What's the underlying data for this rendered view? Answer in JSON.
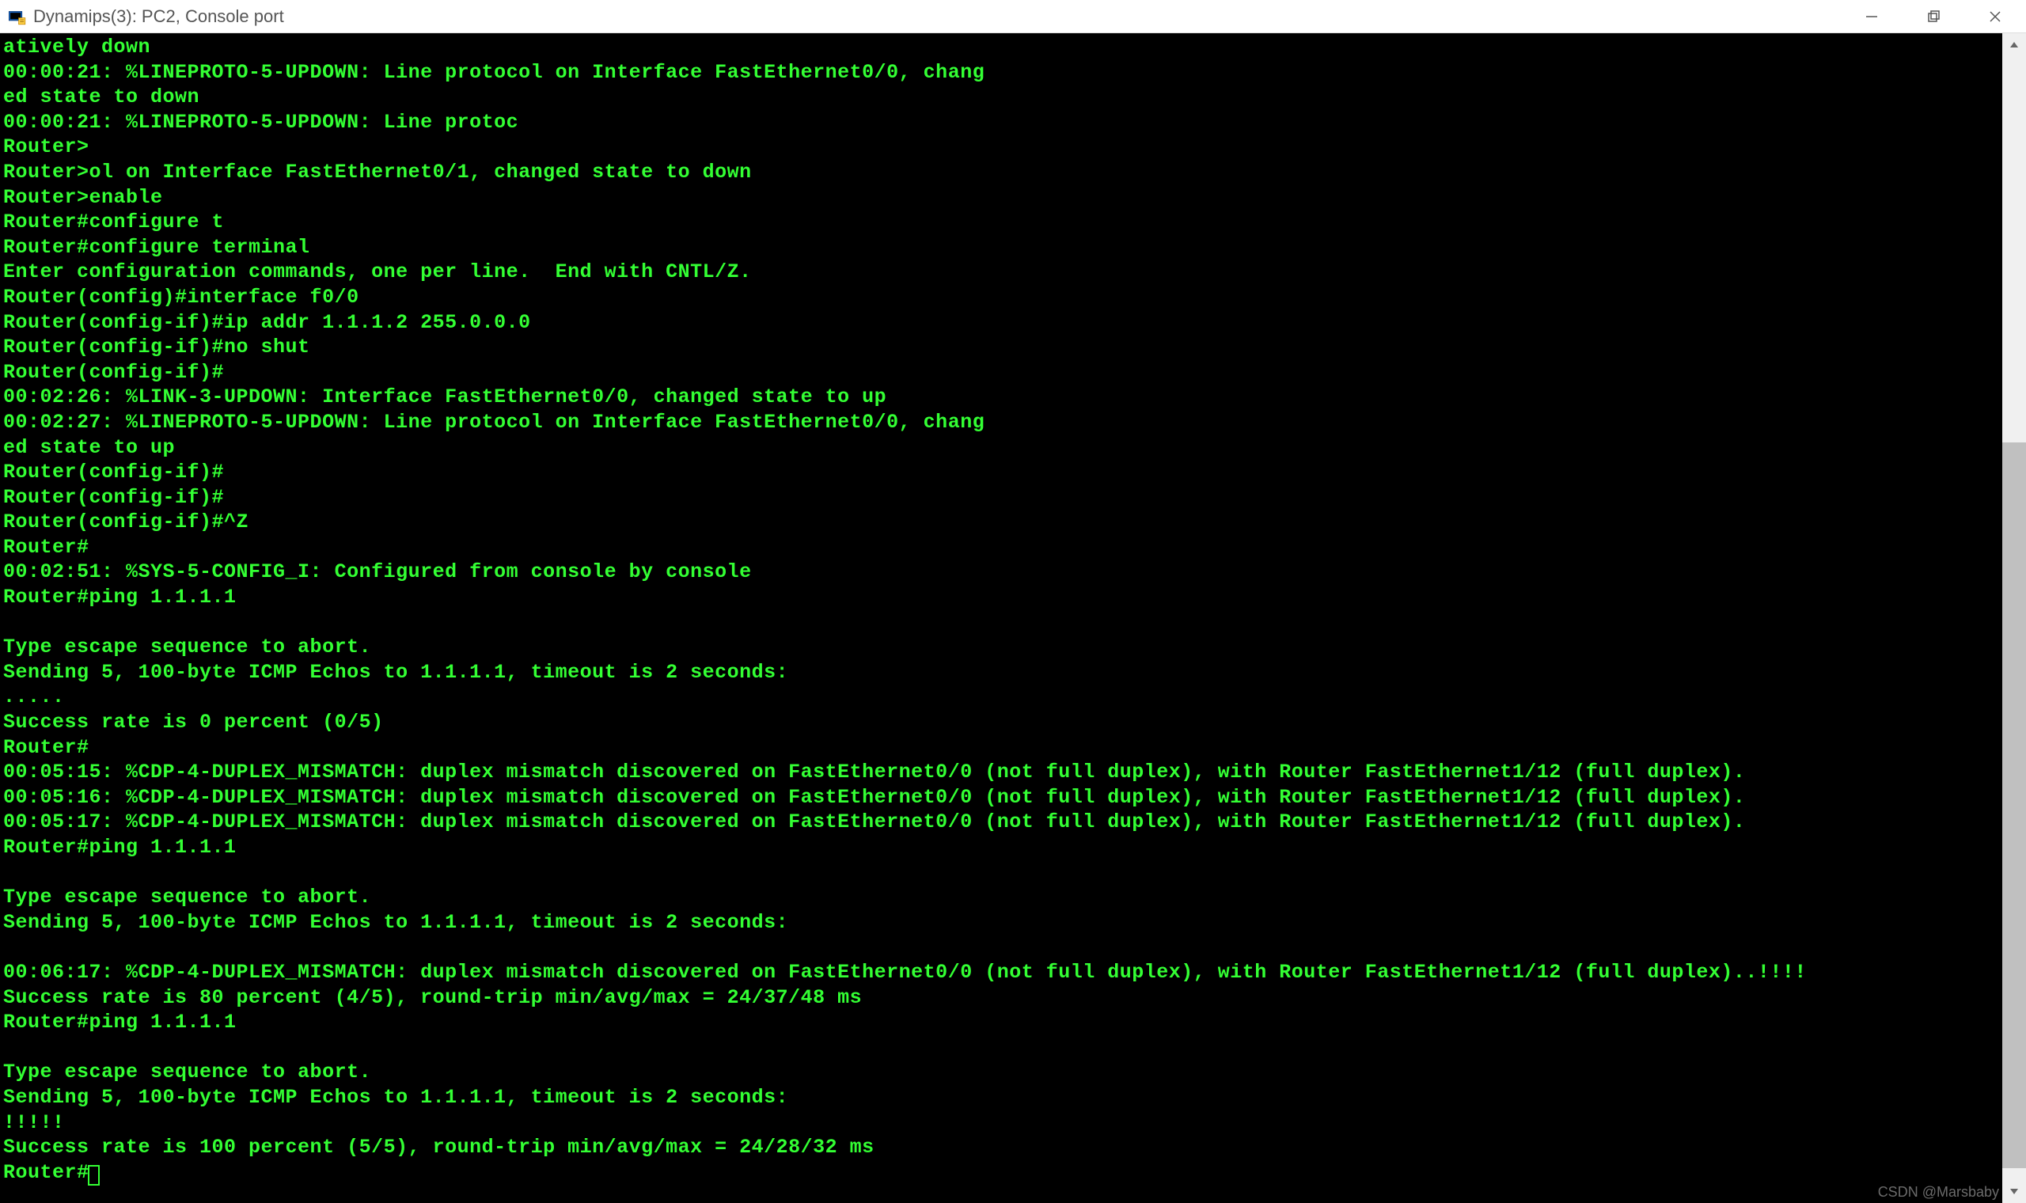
{
  "window": {
    "title": "Dynamips(3): PC2, Console port"
  },
  "terminal": {
    "lines": [
      "atively down",
      "00:00:21: %LINEPROTO-5-UPDOWN: Line protocol on Interface FastEthernet0/0, chang",
      "ed state to down",
      "00:00:21: %LINEPROTO-5-UPDOWN: Line protoc",
      "Router>",
      "Router>ol on Interface FastEthernet0/1, changed state to down",
      "Router>enable",
      "Router#configure t",
      "Router#configure terminal",
      "Enter configuration commands, one per line.  End with CNTL/Z.",
      "Router(config)#interface f0/0",
      "Router(config-if)#ip addr 1.1.1.2 255.0.0.0",
      "Router(config-if)#no shut",
      "Router(config-if)#",
      "00:02:26: %LINK-3-UPDOWN: Interface FastEthernet0/0, changed state to up",
      "00:02:27: %LINEPROTO-5-UPDOWN: Line protocol on Interface FastEthernet0/0, chang",
      "ed state to up",
      "Router(config-if)#",
      "Router(config-if)#",
      "Router(config-if)#^Z",
      "Router#",
      "00:02:51: %SYS-5-CONFIG_I: Configured from console by console",
      "Router#ping 1.1.1.1",
      "",
      "Type escape sequence to abort.",
      "Sending 5, 100-byte ICMP Echos to 1.1.1.1, timeout is 2 seconds:",
      ".....",
      "Success rate is 0 percent (0/5)",
      "Router#",
      "00:05:15: %CDP-4-DUPLEX_MISMATCH: duplex mismatch discovered on FastEthernet0/0 (not full duplex), with Router FastEthernet1/12 (full duplex).",
      "00:05:16: %CDP-4-DUPLEX_MISMATCH: duplex mismatch discovered on FastEthernet0/0 (not full duplex), with Router FastEthernet1/12 (full duplex).",
      "00:05:17: %CDP-4-DUPLEX_MISMATCH: duplex mismatch discovered on FastEthernet0/0 (not full duplex), with Router FastEthernet1/12 (full duplex).",
      "Router#ping 1.1.1.1",
      "",
      "Type escape sequence to abort.",
      "Sending 5, 100-byte ICMP Echos to 1.1.1.1, timeout is 2 seconds:",
      "",
      "00:06:17: %CDP-4-DUPLEX_MISMATCH: duplex mismatch discovered on FastEthernet0/0 (not full duplex), with Router FastEthernet1/12 (full duplex)..!!!!",
      "Success rate is 80 percent (4/5), round-trip min/avg/max = 24/37/48 ms",
      "Router#ping 1.1.1.1",
      "",
      "Type escape sequence to abort.",
      "Sending 5, 100-byte ICMP Echos to 1.1.1.1, timeout is 2 seconds:",
      "!!!!!",
      "Success rate is 100 percent (5/5), round-trip min/avg/max = 24/28/32 ms",
      "Router#"
    ],
    "prompt_cursor": true
  },
  "scrollbar": {
    "thumb_top_pct": 35,
    "thumb_height_pct": 62
  },
  "watermark": "CSDN @Marsbaby"
}
